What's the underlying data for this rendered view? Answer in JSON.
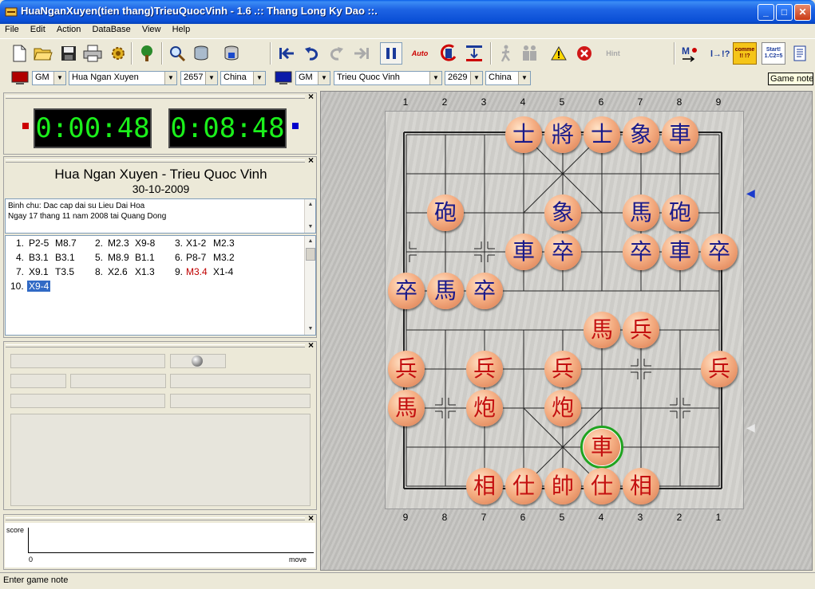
{
  "window": {
    "title": "HuaNganXuyen(tien thang)TrieuQuocVinh - 1.6 .:: Thang Long Ky Dao ::.",
    "controls": [
      "_",
      "□",
      "✕"
    ]
  },
  "menu": [
    "File",
    "Edit",
    "Action",
    "DataBase",
    "View",
    "Help"
  ],
  "toolbar": {
    "auto_label": "Auto",
    "hint_label": "Hint",
    "comment_label": "comme !! !?",
    "start_label": "Start! 1.C2=5"
  },
  "players": {
    "red": {
      "title": "GM",
      "name": "Hua Ngan Xuyen",
      "rating": "2657",
      "country": "China"
    },
    "black": {
      "title": "GM",
      "name": "Trieu Quoc Vinh",
      "rating": "2629",
      "country": "China"
    }
  },
  "tooltip": "Game note",
  "clocks": {
    "red": "0:00:48",
    "black": "0:08:48",
    "colors": {
      "red": "#cc0000",
      "black": "#0000cc",
      "digits": "#1bf01b"
    }
  },
  "game": {
    "title": "Hua Ngan Xuyen - Trieu Quoc Vinh",
    "date": "30-10-2009",
    "comment": [
      "Binh chu: Dac cap dai su Lieu Dai Hoa",
      "Ngay 17 thang 11 nam 2008 tai Quang Dong"
    ]
  },
  "moves": [
    [
      "1.",
      "P2-5",
      "M8.7",
      "2.",
      "M2.3",
      "X9-8",
      "3.",
      "X1-2",
      "M2.3"
    ],
    [
      "4.",
      "B3.1",
      "B3.1",
      "5.",
      "M8.9",
      "B1.1",
      "6.",
      "P8-7",
      "M3.2"
    ],
    [
      "7.",
      "X9.1",
      "T3.5",
      "8.",
      "X2.6",
      "X1.3",
      "9.",
      "M3.4",
      "X1-4"
    ],
    [
      "10.",
      "X9-4"
    ]
  ],
  "graph": {
    "y_label": "score",
    "x_label": "move",
    "origin": "0"
  },
  "status": "Enter game note",
  "board": {
    "top_files": [
      "1",
      "2",
      "3",
      "4",
      "5",
      "6",
      "7",
      "8",
      "9"
    ],
    "bottom_files": [
      "9",
      "8",
      "7",
      "6",
      "5",
      "4",
      "3",
      "2",
      "1"
    ],
    "pieces": [
      {
        "ch": "士",
        "side": "black",
        "c": 3,
        "r": 0
      },
      {
        "ch": "將",
        "side": "black",
        "c": 4,
        "r": 0
      },
      {
        "ch": "士",
        "side": "black",
        "c": 5,
        "r": 0
      },
      {
        "ch": "象",
        "side": "black",
        "c": 6,
        "r": 0
      },
      {
        "ch": "車",
        "side": "black",
        "c": 7,
        "r": 0
      },
      {
        "ch": "砲",
        "side": "black",
        "c": 1,
        "r": 2
      },
      {
        "ch": "象",
        "side": "black",
        "c": 4,
        "r": 2
      },
      {
        "ch": "馬",
        "side": "black",
        "c": 6,
        "r": 2
      },
      {
        "ch": "砲",
        "side": "black",
        "c": 7,
        "r": 2
      },
      {
        "ch": "車",
        "side": "black",
        "c": 3,
        "r": 3
      },
      {
        "ch": "卒",
        "side": "black",
        "c": 4,
        "r": 3
      },
      {
        "ch": "卒",
        "side": "black",
        "c": 6,
        "r": 3
      },
      {
        "ch": "車",
        "side": "black",
        "c": 7,
        "r": 3
      },
      {
        "ch": "卒",
        "side": "black",
        "c": 8,
        "r": 3
      },
      {
        "ch": "卒",
        "side": "black",
        "c": 0,
        "r": 4
      },
      {
        "ch": "馬",
        "side": "black",
        "c": 1,
        "r": 4
      },
      {
        "ch": "卒",
        "side": "black",
        "c": 2,
        "r": 4
      },
      {
        "ch": "馬",
        "side": "red",
        "c": 5,
        "r": 5
      },
      {
        "ch": "兵",
        "side": "red",
        "c": 6,
        "r": 5
      },
      {
        "ch": "兵",
        "side": "red",
        "c": 0,
        "r": 6
      },
      {
        "ch": "兵",
        "side": "red",
        "c": 2,
        "r": 6
      },
      {
        "ch": "兵",
        "side": "red",
        "c": 4,
        "r": 6
      },
      {
        "ch": "兵",
        "side": "red",
        "c": 8,
        "r": 6
      },
      {
        "ch": "馬",
        "side": "red",
        "c": 0,
        "r": 7
      },
      {
        "ch": "炮",
        "side": "red",
        "c": 2,
        "r": 7
      },
      {
        "ch": "炮",
        "side": "red",
        "c": 4,
        "r": 7
      },
      {
        "ch": "車",
        "side": "red",
        "c": 5,
        "r": 8,
        "highlight": true
      },
      {
        "ch": "相",
        "side": "red",
        "c": 2,
        "r": 9
      },
      {
        "ch": "仕",
        "side": "red",
        "c": 3,
        "r": 9
      },
      {
        "ch": "帥",
        "side": "red",
        "c": 4,
        "r": 9
      },
      {
        "ch": "仕",
        "side": "red",
        "c": 5,
        "r": 9
      },
      {
        "ch": "相",
        "side": "red",
        "c": 6,
        "r": 9
      }
    ]
  }
}
